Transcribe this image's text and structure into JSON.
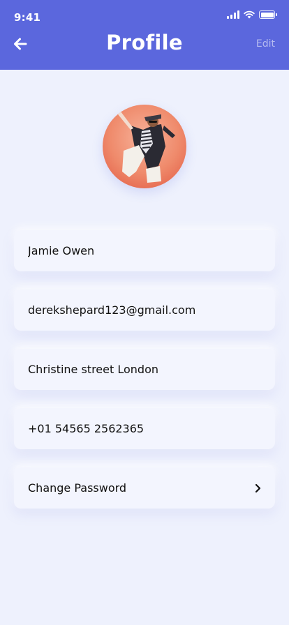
{
  "status_bar": {
    "time": "9:41"
  },
  "header": {
    "title": "Profile",
    "edit_label": "Edit"
  },
  "profile": {
    "name": "Jamie Owen",
    "email": "derekshepard123@gmail.com",
    "address": "Christine street London",
    "phone": "+01 54565 2562365"
  },
  "actions": {
    "change_password_label": "Change Password"
  },
  "colors": {
    "header_bg": "#5b67dd",
    "page_bg": "#eef1fd",
    "field_bg": "#f3f5fe"
  }
}
